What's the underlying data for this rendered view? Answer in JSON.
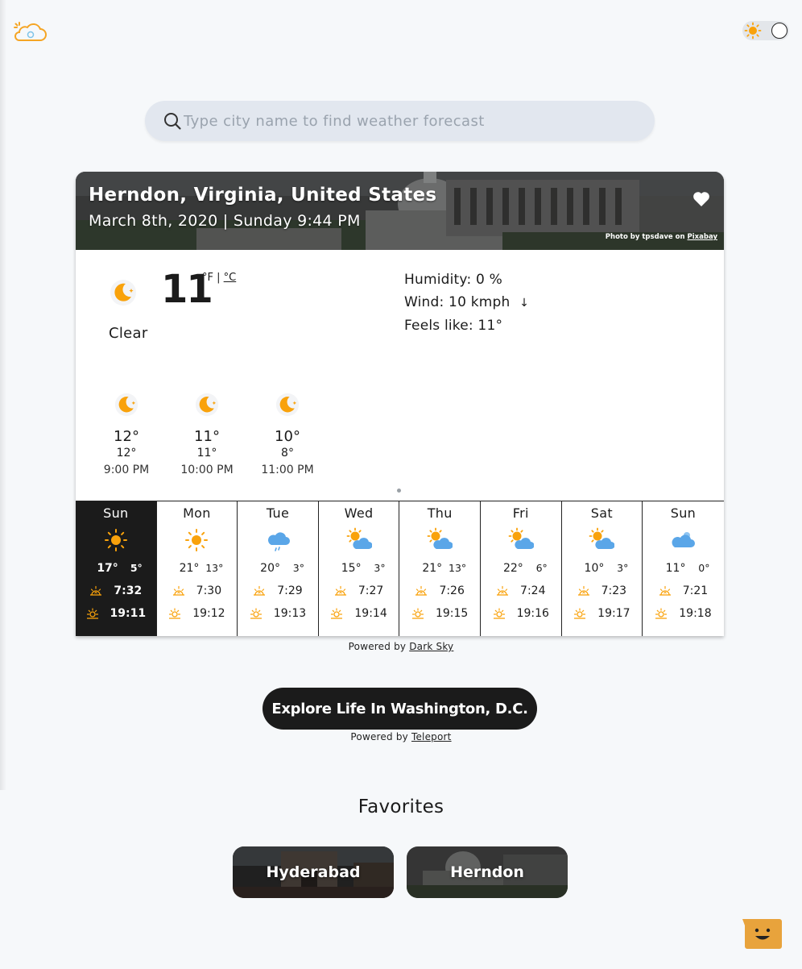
{
  "header": {
    "logo_icon": "cloud-sun-logo-icon",
    "theme_toggle_icon": "sun-icon"
  },
  "search": {
    "placeholder": "Type city name to find weather forecast",
    "value": ""
  },
  "location": {
    "city": "Herndon, Virginia, United States",
    "datetime": "March 8th, 2020 | Sunday 9:44 PM",
    "photo_credit_prefix": "Photo by tpsdave on",
    "photo_credit_link": "Pixabay"
  },
  "current": {
    "icon": "clear-night-icon",
    "temperature": "11",
    "unit_f": "°F",
    "unit_sep": "|",
    "unit_c": "°C",
    "summary": "Clear",
    "humidity": "Humidity:  0 %",
    "wind": "Wind: 10 kmph",
    "wind_arrow": "↓",
    "feels_like": "Feels like: 11°"
  },
  "hourly": [
    {
      "temp": "12°",
      "feels": "12°",
      "time": "9:00 PM",
      "icon": "clear-night-icon"
    },
    {
      "temp": "11°",
      "feels": "11°",
      "time": "10:00 PM",
      "icon": "clear-night-icon"
    },
    {
      "temp": "10°",
      "feels": "8°",
      "time": "11:00 PM",
      "icon": "clear-night-icon"
    }
  ],
  "daily": [
    {
      "day": "Sun",
      "icon": "sunny",
      "hi": "17°",
      "lo": "5°",
      "sunrise": "7:32",
      "sunset": "19:11",
      "active": true
    },
    {
      "day": "Mon",
      "icon": "sunny",
      "hi": "21°",
      "lo": "13°",
      "sunrise": "7:30",
      "sunset": "19:12"
    },
    {
      "day": "Tue",
      "icon": "rain",
      "hi": "20°",
      "lo": "3°",
      "sunrise": "7:29",
      "sunset": "19:13"
    },
    {
      "day": "Wed",
      "icon": "partly-cloudy",
      "hi": "15°",
      "lo": "3°",
      "sunrise": "7:27",
      "sunset": "19:14"
    },
    {
      "day": "Thu",
      "icon": "partly-cloudy",
      "hi": "21°",
      "lo": "13°",
      "sunrise": "7:26",
      "sunset": "19:15"
    },
    {
      "day": "Fri",
      "icon": "partly-cloudy",
      "hi": "22°",
      "lo": "6°",
      "sunrise": "7:24",
      "sunset": "19:16"
    },
    {
      "day": "Sat",
      "icon": "partly-cloudy",
      "hi": "10°",
      "lo": "3°",
      "sunrise": "7:23",
      "sunset": "19:17"
    },
    {
      "day": "Sun",
      "icon": "cloudy",
      "hi": "11°",
      "lo": "0°",
      "sunrise": "7:21",
      "sunset": "19:18"
    }
  ],
  "powered_darksky": {
    "prefix": "Powered by",
    "link": "Dark Sky"
  },
  "explore": {
    "label": "Explore Life In Washington, D.C."
  },
  "powered_teleport": {
    "prefix": "Powered by",
    "link": "Teleport"
  },
  "favorites": {
    "title": "Favorites",
    "items": [
      {
        "name": "Hyderabad"
      },
      {
        "name": "Herndon"
      }
    ]
  },
  "colors": {
    "accent": "#f9a20b",
    "dark": "#1b1b1b",
    "cloud": "#5aa6e8",
    "background": "#f6f8fa"
  }
}
